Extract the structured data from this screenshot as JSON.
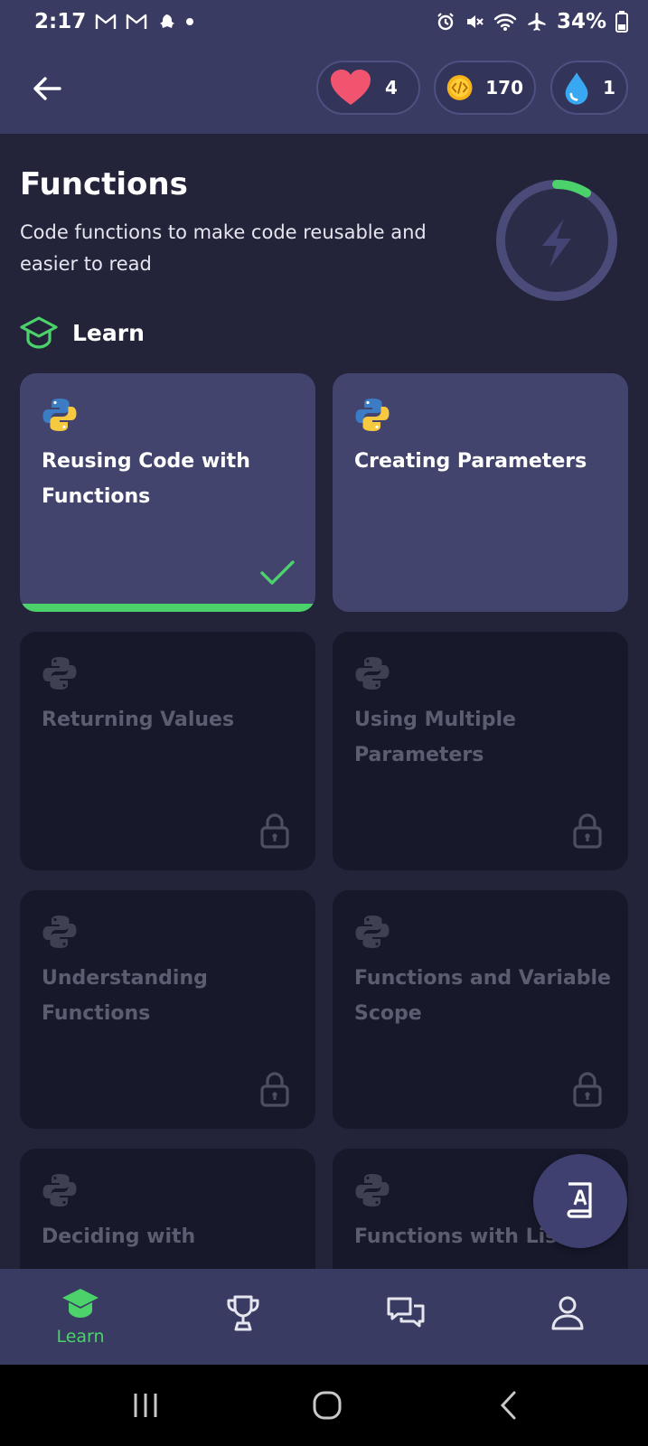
{
  "status_bar": {
    "time": "2:17",
    "battery": "34%"
  },
  "header": {
    "hearts": "4",
    "coins": "170",
    "streak": "1"
  },
  "page": {
    "title": "Functions",
    "subtitle": "Code functions to make code reusable and easier to read",
    "section_label": "Learn"
  },
  "lessons": [
    {
      "title": "Reusing Code with Functions",
      "state": "completed"
    },
    {
      "title": "Creating Parameters",
      "state": "available"
    },
    {
      "title": "Returning Values",
      "state": "locked"
    },
    {
      "title": "Using Multiple Parameters",
      "state": "locked"
    },
    {
      "title": "Understanding Functions",
      "state": "locked"
    },
    {
      "title": "Functions and Variable Scope",
      "state": "locked"
    },
    {
      "title": "Deciding with",
      "state": "locked"
    },
    {
      "title": "Functions with Lists",
      "state": "locked"
    }
  ],
  "bottom_nav": {
    "learn_label": "Learn"
  },
  "colors": {
    "accent_green": "#4bd26b",
    "header_bg": "#3a3b62",
    "page_bg": "#23243a",
    "card_unlocked": "#43446e",
    "card_locked": "#17182a"
  },
  "icons": {
    "back": "arrow-left-icon",
    "hearts": "heart-icon",
    "coins": "code-coin-icon",
    "streak": "water-drop-icon",
    "progress": "lightning-icon",
    "section": "graduation-cap-icon",
    "lesson": "python-logo-icon",
    "fab": "dictionary-book-icon"
  }
}
